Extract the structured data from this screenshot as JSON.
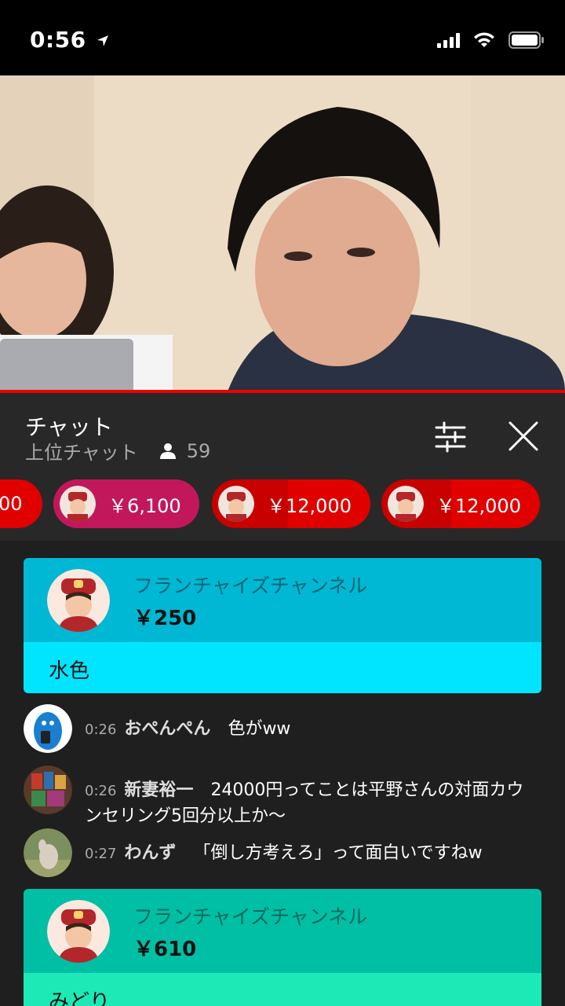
{
  "status": {
    "time": "0:56"
  },
  "chat": {
    "title": "チャット",
    "subtitle": "上位チャット",
    "viewer_count": "59"
  },
  "tickers": [
    {
      "amount": "00",
      "color": "#e00000"
    },
    {
      "amount": "￥6,100",
      "color": "#c2185b"
    },
    {
      "amount": "￥12,000",
      "color": "#e00000"
    },
    {
      "amount": "￥12,000",
      "color": "#e00000"
    }
  ],
  "superchats": [
    {
      "name": "フランチャイズチャンネル",
      "amount": "￥250",
      "message": "水色",
      "top_color": "#00b8d4",
      "bottom_color": "#00e5ff"
    },
    {
      "name": "フランチャイズチャンネル",
      "amount": "￥610",
      "message": "みどり",
      "top_color": "#00bfa5",
      "bottom_color": "#1de9b6"
    }
  ],
  "messages": [
    {
      "time": "0:26",
      "author": "おぺんぺん",
      "text": "色がww"
    },
    {
      "time": "0:26",
      "author": "新妻裕一",
      "text": "24000円ってことは平野さんの対面カウンセリング5回分以上か〜"
    },
    {
      "time": "0:27",
      "author": "わんず",
      "text": "「倒し方考えろ」って面白いですねw"
    }
  ],
  "icons": {
    "status": [
      "location-arrow-icon",
      "cellular-signal-icon",
      "wifi-icon",
      "battery-icon"
    ],
    "chat_header": [
      "person-icon",
      "tune-icon",
      "close-icon"
    ]
  },
  "colors": {
    "progress": "#ee0000",
    "chat_background": "#1f1f1f",
    "header_background": "#282828"
  }
}
